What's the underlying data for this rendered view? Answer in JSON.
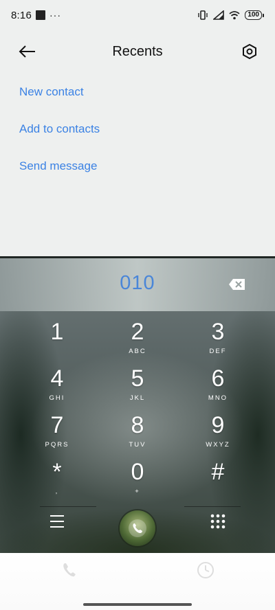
{
  "status": {
    "time": "8:16",
    "dots": "···",
    "battery": "100"
  },
  "header": {
    "title": "Recents",
    "back_icon": "arrow-left-icon",
    "settings_icon": "gear-hex-icon"
  },
  "actions": [
    {
      "label": "New contact"
    },
    {
      "label": "Add to contacts"
    },
    {
      "label": "Send message"
    }
  ],
  "dialer": {
    "number": "010",
    "keys": [
      {
        "digit": "1",
        "letters": ""
      },
      {
        "digit": "2",
        "letters": "ABC"
      },
      {
        "digit": "3",
        "letters": "DEF"
      },
      {
        "digit": "4",
        "letters": "GHI"
      },
      {
        "digit": "5",
        "letters": "JKL"
      },
      {
        "digit": "6",
        "letters": "MNO"
      },
      {
        "digit": "7",
        "letters": "PQRS"
      },
      {
        "digit": "8",
        "letters": "TUV"
      },
      {
        "digit": "9",
        "letters": "WXYZ"
      },
      {
        "digit": "*",
        "letters": ","
      },
      {
        "digit": "0",
        "letters": "+"
      },
      {
        "digit": "#",
        "letters": ""
      }
    ]
  },
  "colors": {
    "accent": "#3b82e4",
    "background": "#eef0ef",
    "dialed_number": "#4a86d8"
  }
}
